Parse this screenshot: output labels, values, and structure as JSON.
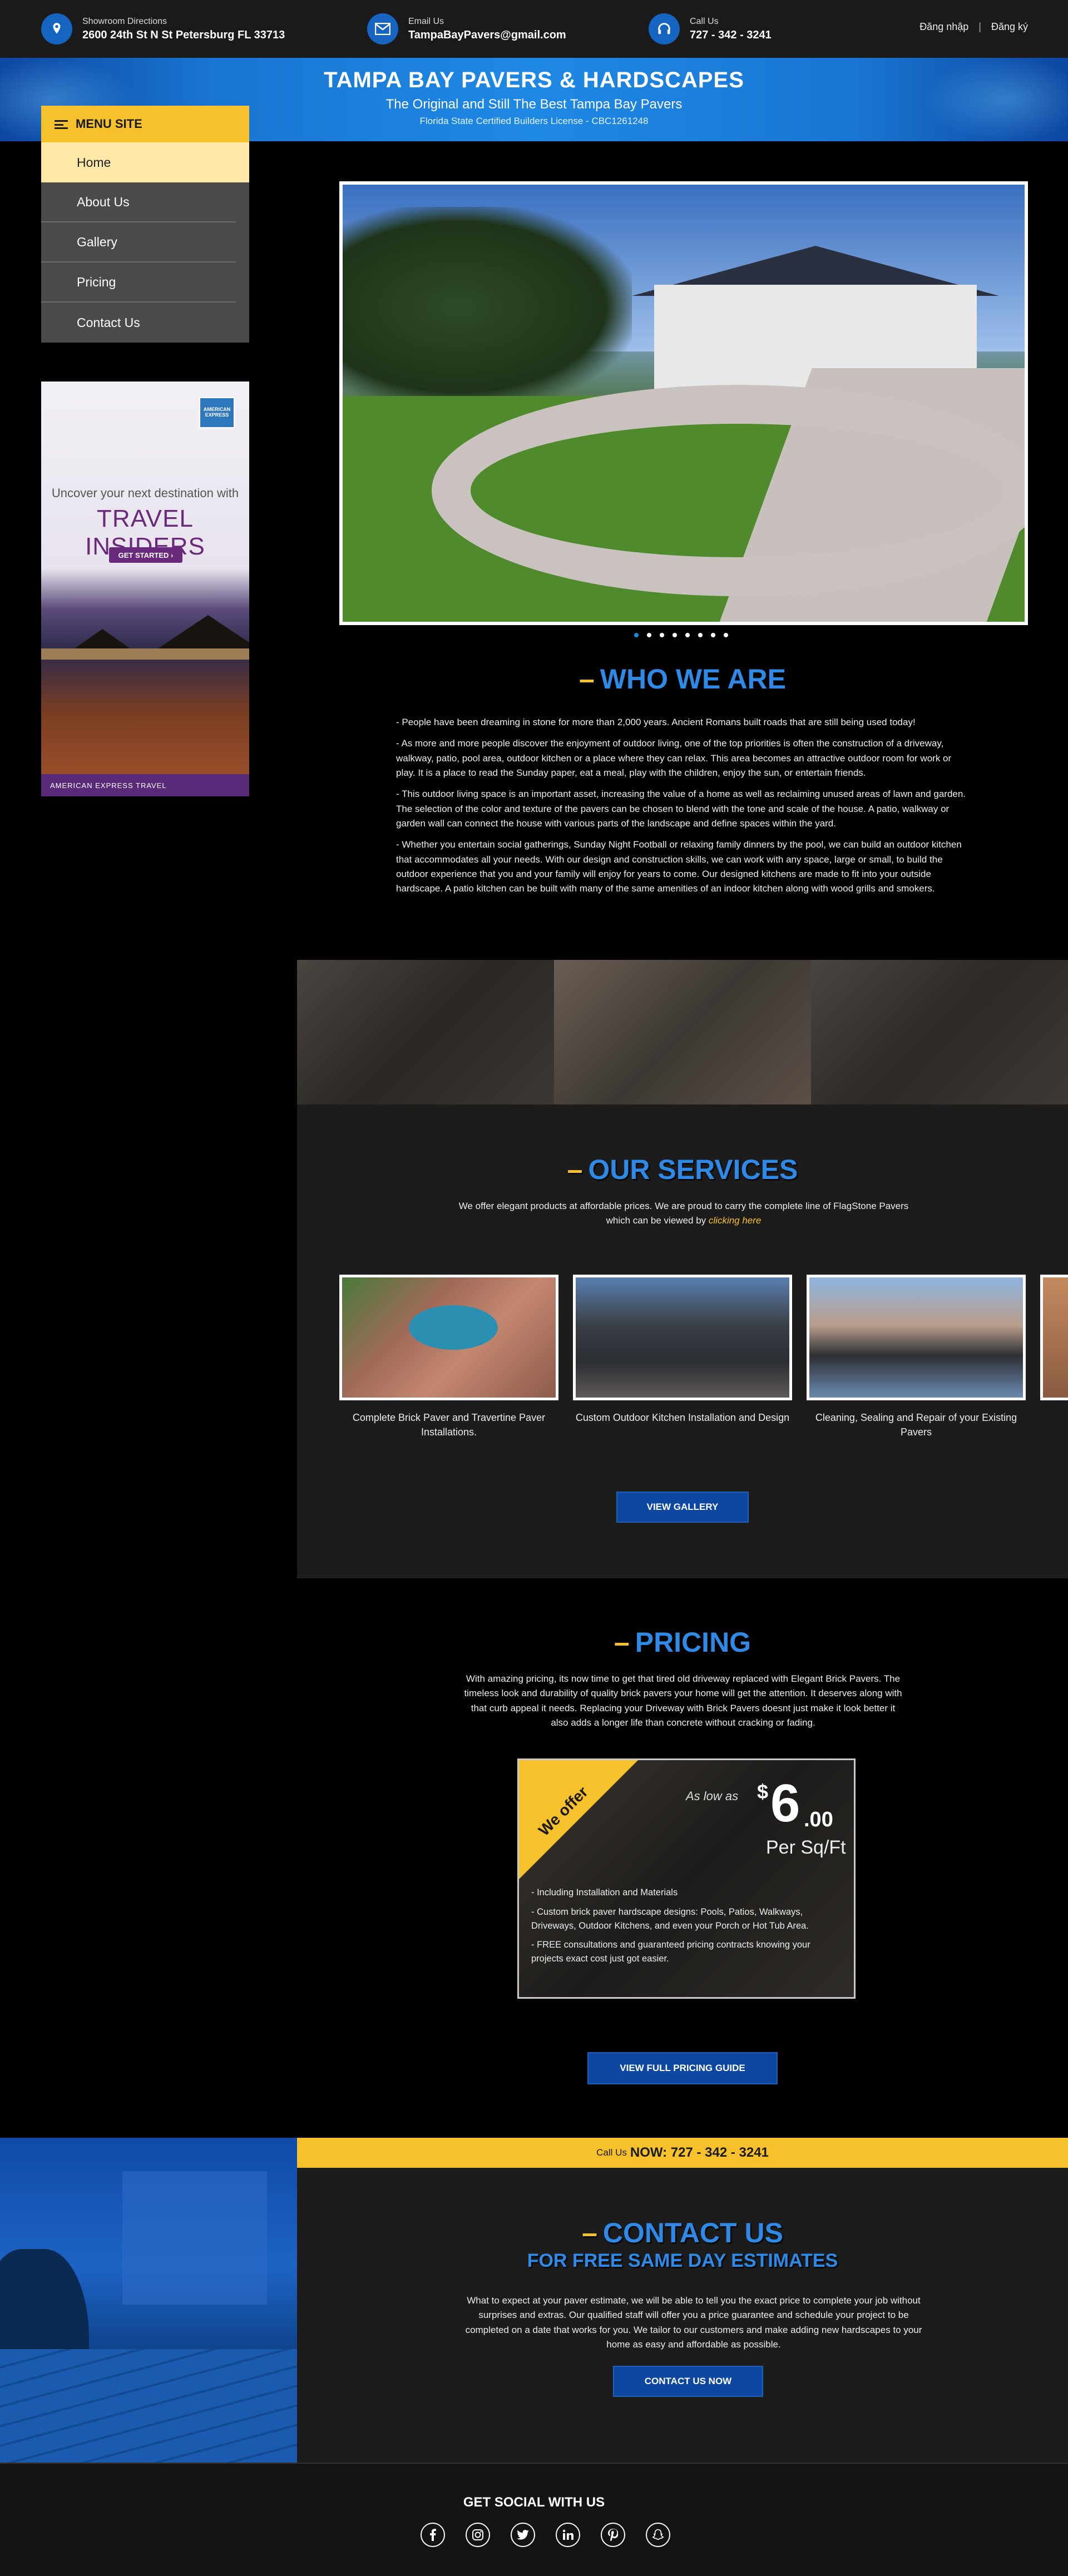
{
  "topbar": {
    "showroom": {
      "label": "Showroom Directions",
      "value": "2600 24th St N St Petersburg FL 33713"
    },
    "email": {
      "label": "Email Us",
      "value": "TampaBayPavers@gmail.com"
    },
    "call": {
      "label": "Call Us",
      "value": "727 - 342 - 3241"
    },
    "login": "Đăng nhập",
    "register": "Đăng ký"
  },
  "banner": {
    "title": "TAMPA BAY PAVERS & HARDSCAPES",
    "subtitle": "The Original and Still The Best Tampa Bay Pavers",
    "license": "Florida State Certified Builders License - CBC1261248"
  },
  "menu": {
    "title": "MENU SITE",
    "items": [
      "Home",
      "About Us",
      "Gallery",
      "Pricing",
      "Contact Us"
    ]
  },
  "ad": {
    "brand": "AMERICAN EXPRESS",
    "line1": "Uncover your next destination with",
    "line2": "TRAVEL INSIDERS",
    "button": "GET STARTED",
    "footer": "AMERICAN EXPRESS TRAVEL"
  },
  "slider": {
    "dots": 8,
    "active": 0
  },
  "who": {
    "heading": "WHO WE ARE",
    "paragraphs": [
      "- People have been dreaming in stone for more than 2,000 years. Ancient Romans built roads that are still being used today!",
      "- As more and more people discover the enjoyment of outdoor living, one of the top priorities is often the construction of a driveway, walkway, patio, pool area, outdoor kitchen or a place where they can relax. This area becomes an attractive outdoor room for work or play. It is a place to read the Sunday paper, eat a meal, play with the children, enjoy the sun, or entertain friends.",
      "- This outdoor living space is an important asset, increasing the value of a home as well as reclaiming unused areas of lawn and garden. The selection of the color and texture of the pavers can be chosen to blend with the tone and scale of the house. A patio, walkway or garden wall can connect the house with various parts of the landscape and define spaces within the yard.",
      "- Whether you entertain social gatherings, Sunday Night Football or relaxing family dinners by the pool, we can build an outdoor kitchen that accommodates all your needs.  With our design and construction skills, we can work with any space, large or small, to build the outdoor experience that you and your family will enjoy for years to come.  Our designed kitchens are made to fit into your outside hardscape.  A patio kitchen can be built with many of the same amenities of an indoor kitchen along with wood grills and smokers."
    ]
  },
  "services": {
    "heading": "OUR SERVICES",
    "intro": "We offer elegant products at affordable prices. We are proud to carry the complete line of FlagStone Pavers which can be viewed by",
    "link": "clicking here",
    "cards": [
      "Complete Brick Paver and Travertine Paver Installations.",
      "Custom Outdoor Kitchen Installation and Design",
      "Cleaning, Sealing and Repair of your Existing Pavers"
    ],
    "button": "VIEW GALLERY"
  },
  "pricing": {
    "heading": "PRICING",
    "intro": "With amazing pricing, its now time to get that tired old driveway replaced with Elegant Brick Pavers. The timeless look and durability of quality brick pavers your home will get the attention. It deserves along with that curb appeal it needs. Replacing your Driveway with Brick Pavers doesnt just make it look better it also adds a longer life than concrete without cracking or fading.",
    "ribbon": "We offer",
    "as_low_as": "As low as",
    "currency": "$",
    "price_whole": "6",
    "price_cents": ".00",
    "unit": "Per Sq/Ft",
    "bullets": [
      "- Including Installation and Materials",
      "- Custom brick paver hardscape designs: Pools, Patios, Walkways, Driveways, Outdoor Kitchens, and even your Porch or Hot Tub  Area.",
      "- FREE consultations and guaranteed pricing contracts knowing your projects exact cost just got easier."
    ],
    "button": "VIEW FULL PRICING GUIDE"
  },
  "callbar": {
    "prefix": "Call Us",
    "number": "NOW: 727 - 342 - 3241"
  },
  "contact": {
    "heading": "CONTACT US",
    "subheading": "FOR FREE SAME DAY ESTIMATES",
    "text": "What to expect at your paver estimate, we will be able to tell you the exact price to complete your job without surprises and extras.  Our qualified staff will offer you a price guarantee and schedule your project to be completed on a date that works for you.  We tailor to our customers and make adding new hardscapes to your home as easy and affordable as possible.",
    "button": "CONTACT US NOW"
  },
  "footer": {
    "title": "GET SOCIAL WITH US",
    "icons": [
      "facebook-icon",
      "instagram-icon",
      "twitter-icon",
      "linkedin-icon",
      "pinterest-icon",
      "snapchat-icon"
    ]
  },
  "colors": {
    "accent": "#f7c12c",
    "brand_blue": "#1e88e5",
    "heading_blue": "#2e8ae6",
    "dark_bg": "#1c1c1c"
  }
}
